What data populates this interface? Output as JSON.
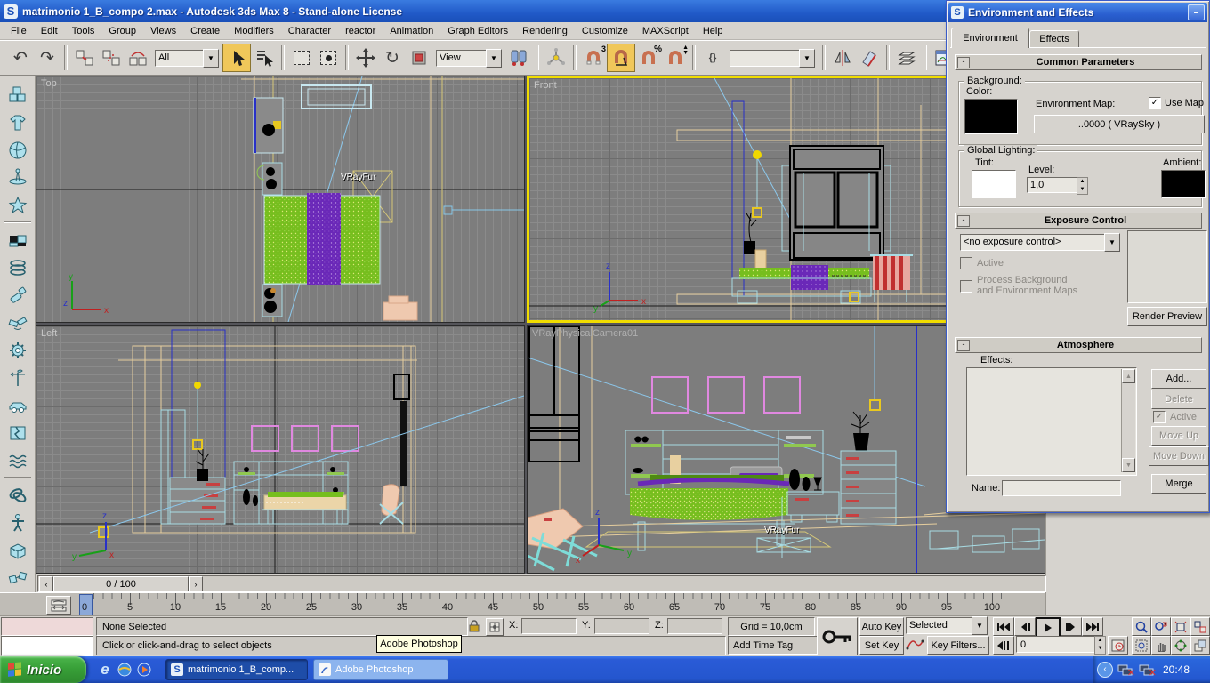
{
  "window": {
    "title": "matrimonio 1_B_compo 2.max - Autodesk 3ds Max 8  - Stand-alone License"
  },
  "menu": {
    "items": [
      "File",
      "Edit",
      "Tools",
      "Group",
      "Views",
      "Create",
      "Modifiers",
      "Character",
      "reactor",
      "Animation",
      "Graph Editors",
      "Rendering",
      "Customize",
      "MAXScript",
      "Help"
    ]
  },
  "toolbar": {
    "selection_filter": "All",
    "coord_system": "View",
    "snap_badge": "3",
    "named_selection": ""
  },
  "viewports": {
    "top_label": "Top",
    "front_label": "Front",
    "left_label": "Left",
    "camera_label": "VRayPhysicalCamera01",
    "vrayfur_label": "VRayFur"
  },
  "dialog": {
    "title": "Environment and Effects",
    "tab_environment": "Environment",
    "tab_effects": "Effects",
    "common": {
      "title": "Common Parameters",
      "background_label": "Background:",
      "color_label": "Color:",
      "env_map_label": "Environment Map:",
      "use_map_label": "Use Map",
      "map_button": "..0000  ( VRaySky )",
      "global_lighting_label": "Global Lighting:",
      "tint_label": "Tint:",
      "level_label": "Level:",
      "level_value": "1,0",
      "ambient_label": "Ambient:"
    },
    "exposure": {
      "title": "Exposure Control",
      "dropdown_value": "<no exposure control>",
      "active_label": "Active",
      "process_label_1": "Process Background",
      "process_label_2": "and Environment Maps",
      "render_preview": "Render Preview"
    },
    "atmosphere": {
      "title": "Atmosphere",
      "effects_label": "Effects:",
      "add": "Add...",
      "delete": "Delete",
      "active": "Active",
      "move_up": "Move Up",
      "move_down": "Move Down",
      "merge": "Merge",
      "name_label": "Name:"
    }
  },
  "timeline": {
    "slider": "0 / 100",
    "ticks": [
      "0",
      "5",
      "10",
      "15",
      "20",
      "25",
      "30",
      "35",
      "40",
      "45",
      "50",
      "55",
      "60",
      "65",
      "70",
      "75",
      "80",
      "85",
      "90",
      "95",
      "100"
    ]
  },
  "status": {
    "selection": "None Selected",
    "prompt": "Click or click-and-drag to select objects",
    "x_label": "X:",
    "y_label": "Y:",
    "z_label": "Z:",
    "grid": "Grid = 10,0cm",
    "add_time_tag": "Add Time Tag",
    "auto_key": "Auto Key",
    "set_key": "Set Key",
    "selected_dropdown": "Selected",
    "key_filters": "Key Filters...",
    "frame": "0",
    "tooltip": "Adobe Photoshop"
  },
  "taskbar": {
    "start": "Inicio",
    "task1": "matrimonio 1_B_comp...",
    "task2": "Adobe Photoshop",
    "clock": "20:48"
  }
}
